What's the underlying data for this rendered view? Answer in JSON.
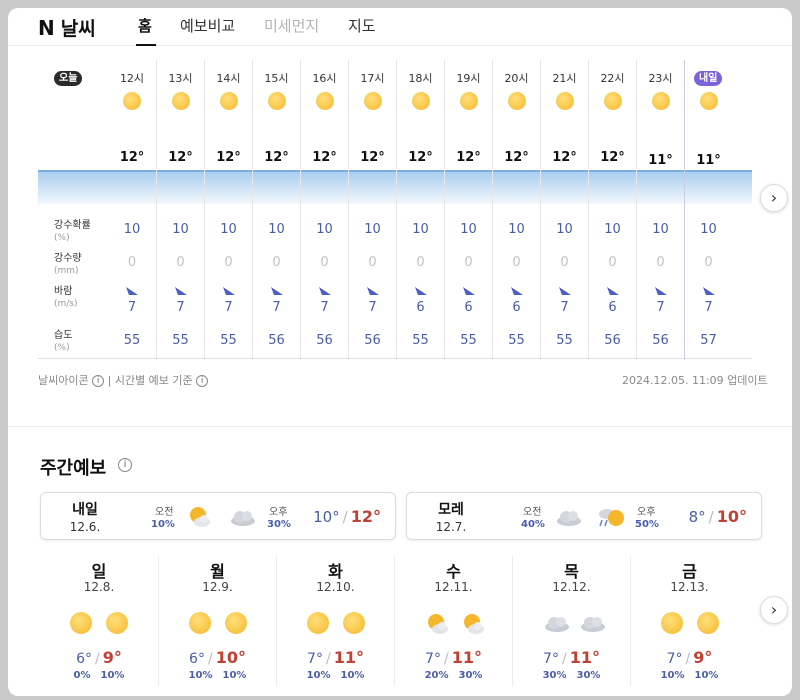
{
  "header": {
    "logo_n": "N",
    "logo_text": "날씨",
    "tabs": [
      {
        "label": "홈",
        "state": "active"
      },
      {
        "label": "예보비교",
        "state": "normal"
      },
      {
        "label": "미세먼지",
        "state": "disabled"
      },
      {
        "label": "지도",
        "state": "normal"
      }
    ]
  },
  "hourly": {
    "today_badge": "오늘",
    "tomorrow_badge": "내일",
    "row_labels": {
      "precip_prob": "강수확률",
      "precip_prob_unit": "(%)",
      "precip_amt": "강수량",
      "precip_amt_unit": "(mm)",
      "wind": "바람",
      "wind_unit": "(m/s)",
      "humidity": "습도",
      "humidity_unit": "(%)"
    },
    "hours": [
      {
        "time": "12시",
        "temp": "12°",
        "precip_prob": "10",
        "precip_amt": "0",
        "wind": "7",
        "humidity": "55",
        "icon": "sun-icon"
      },
      {
        "time": "13시",
        "temp": "12°",
        "precip_prob": "10",
        "precip_amt": "0",
        "wind": "7",
        "humidity": "55",
        "icon": "sun-icon"
      },
      {
        "time": "14시",
        "temp": "12°",
        "precip_prob": "10",
        "precip_amt": "0",
        "wind": "7",
        "humidity": "55",
        "icon": "sun-icon"
      },
      {
        "time": "15시",
        "temp": "12°",
        "precip_prob": "10",
        "precip_amt": "0",
        "wind": "7",
        "humidity": "56",
        "icon": "sun-icon"
      },
      {
        "time": "16시",
        "temp": "12°",
        "precip_prob": "10",
        "precip_amt": "0",
        "wind": "7",
        "humidity": "56",
        "icon": "sun-icon"
      },
      {
        "time": "17시",
        "temp": "12°",
        "precip_prob": "10",
        "precip_amt": "0",
        "wind": "7",
        "humidity": "56",
        "icon": "sun-icon"
      },
      {
        "time": "18시",
        "temp": "12°",
        "precip_prob": "10",
        "precip_amt": "0",
        "wind": "6",
        "humidity": "55",
        "icon": "sun-icon"
      },
      {
        "time": "19시",
        "temp": "12°",
        "precip_prob": "10",
        "precip_amt": "0",
        "wind": "6",
        "humidity": "55",
        "icon": "sun-icon"
      },
      {
        "time": "20시",
        "temp": "12°",
        "precip_prob": "10",
        "precip_amt": "0",
        "wind": "6",
        "humidity": "55",
        "icon": "sun-icon"
      },
      {
        "time": "21시",
        "temp": "12°",
        "precip_prob": "10",
        "precip_amt": "0",
        "wind": "7",
        "humidity": "55",
        "icon": "sun-icon"
      },
      {
        "time": "22시",
        "temp": "12°",
        "precip_prob": "10",
        "precip_amt": "0",
        "wind": "6",
        "humidity": "56",
        "icon": "sun-icon"
      },
      {
        "time": "23시",
        "temp": "11°",
        "precip_prob": "10",
        "precip_amt": "0",
        "wind": "7",
        "humidity": "56",
        "icon": "sun-icon"
      },
      {
        "time": "",
        "temp": "11°",
        "precip_prob": "10",
        "precip_amt": "0",
        "wind": "7",
        "humidity": "57",
        "icon": "sun-icon",
        "tomorrow": true
      }
    ],
    "footer_left_1": "날씨아이콘",
    "footer_left_sep": "|",
    "footer_left_2": "시간별 예보 기준",
    "footer_right": "2024.12.05. 11:09 업데이트"
  },
  "weekly": {
    "title": "주간예보",
    "am_label": "오전",
    "pm_label": "오후",
    "near_days": [
      {
        "day": "내일",
        "date": "12.6.",
        "am_pct": "10%",
        "pm_pct": "30%",
        "low": "10°",
        "high": "12°",
        "am_icon": "partly-cloudy-icon",
        "pm_icon": "cloud-icon"
      },
      {
        "day": "모레",
        "date": "12.7.",
        "am_pct": "40%",
        "pm_pct": "50%",
        "low": "8°",
        "high": "10°",
        "am_icon": "cloud-icon",
        "pm_icon": "sun-shower-icon"
      }
    ],
    "days": [
      {
        "day": "일",
        "date": "12.8.",
        "low": "6°",
        "high": "9°",
        "am_pct": "0%",
        "pm_pct": "10%",
        "am_icon": "sun-icon",
        "pm_icon": "sun-icon"
      },
      {
        "day": "월",
        "date": "12.9.",
        "low": "6°",
        "high": "10°",
        "am_pct": "10%",
        "pm_pct": "10%",
        "am_icon": "sun-icon",
        "pm_icon": "sun-icon"
      },
      {
        "day": "화",
        "date": "12.10.",
        "low": "7°",
        "high": "11°",
        "am_pct": "10%",
        "pm_pct": "10%",
        "am_icon": "sun-icon",
        "pm_icon": "sun-icon"
      },
      {
        "day": "수",
        "date": "12.11.",
        "low": "7°",
        "high": "11°",
        "am_pct": "20%",
        "pm_pct": "30%",
        "am_icon": "partly-cloudy-icon",
        "pm_icon": "partly-cloudy-icon"
      },
      {
        "day": "목",
        "date": "12.12.",
        "low": "7°",
        "high": "11°",
        "am_pct": "30%",
        "pm_pct": "30%",
        "am_icon": "cloud-icon",
        "pm_icon": "cloud-icon"
      },
      {
        "day": "금",
        "date": "12.13.",
        "low": "7°",
        "high": "9°",
        "am_pct": "10%",
        "pm_pct": "10%",
        "am_icon": "sun-icon",
        "pm_icon": "sun-icon"
      }
    ],
    "slash": "/"
  },
  "colors": {
    "accent_blue": "#4a5ea8",
    "high_temp": "#c24033",
    "tomorrow_badge": "#7a63d8",
    "sun": "#f4b62a"
  }
}
